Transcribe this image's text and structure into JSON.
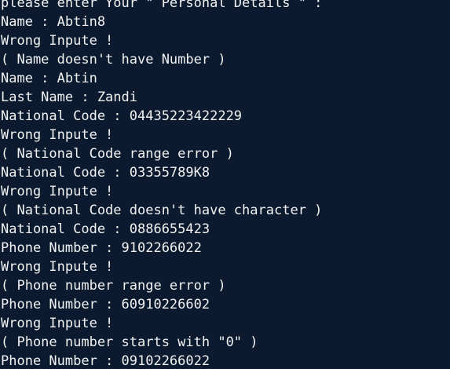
{
  "terminal": {
    "lines": [
      "please enter Your \" Personal Details \" :",
      "Name : Abtin8",
      "Wrong Inpute !",
      "( Name doesn't have Number )",
      "Name : Abtin",
      "Last Name : Zandi",
      "National Code : 04435223422229",
      "Wrong Inpute !",
      "( National Code range error )",
      "National Code : 03355789K8",
      "Wrong Inpute !",
      "( National Code doesn't have character )",
      "National Code : 0886655423",
      "Phone Number : 9102266022",
      "Wrong Inpute !",
      "( Phone number range error )",
      "Phone Number : 60910226602",
      "Wrong Inpute !",
      "( Phone number starts with \"0\" )",
      "Phone Number : 09102266022"
    ]
  }
}
